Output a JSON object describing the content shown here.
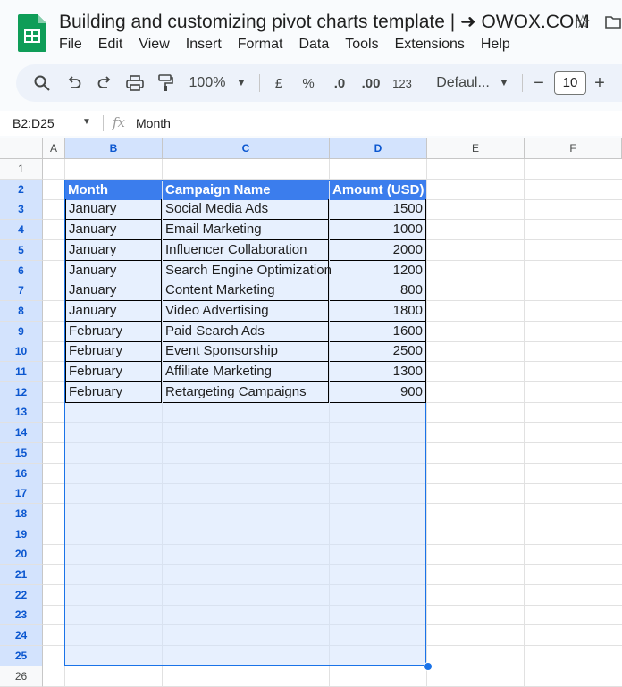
{
  "app": {
    "title": "Building and customizing pivot charts template | ➜ OWOX.COM",
    "menu": [
      "File",
      "Edit",
      "View",
      "Insert",
      "Format",
      "Data",
      "Tools",
      "Extensions",
      "Help"
    ]
  },
  "toolbar": {
    "zoom": "100%",
    "currency": "£",
    "percent": "%",
    "dec_decrease": ".0",
    "dec_increase": ".00",
    "number_format": "123",
    "font": "Defaul...",
    "font_size": "10",
    "minus": "−",
    "plus": "+"
  },
  "formula_bar": {
    "name_box": "B2:D25",
    "fx": "fx",
    "content": "Month"
  },
  "columns": [
    "A",
    "B",
    "C",
    "D",
    "E",
    "F"
  ],
  "rows": [
    "1",
    "2",
    "3",
    "4",
    "5",
    "6",
    "7",
    "8",
    "9",
    "10",
    "11",
    "12",
    "13",
    "14",
    "15",
    "16",
    "17",
    "18",
    "19",
    "20",
    "21",
    "22",
    "23",
    "24",
    "25",
    "26"
  ],
  "table": {
    "headers": [
      "Month",
      "Campaign Name",
      "Amount (USD)"
    ],
    "rows": [
      [
        "January",
        "Social Media Ads",
        "1500"
      ],
      [
        "January",
        "Email Marketing",
        "1000"
      ],
      [
        "January",
        "Influencer Collaboration",
        "2000"
      ],
      [
        "January",
        "Search Engine Optimization",
        "1200"
      ],
      [
        "January",
        "Content Marketing",
        "800"
      ],
      [
        "January",
        "Video Advertising",
        "1800"
      ],
      [
        "February",
        "Paid Search Ads",
        "1600"
      ],
      [
        "February",
        "Event Sponsorship",
        "2500"
      ],
      [
        "February",
        "Affiliate Marketing",
        "1300"
      ],
      [
        "February",
        "Retargeting Campaigns",
        "900"
      ]
    ]
  },
  "colors": {
    "header_fill": "#3b7ded",
    "selection_border": "#1a73e8",
    "sheets_green": "#0f9d58"
  }
}
